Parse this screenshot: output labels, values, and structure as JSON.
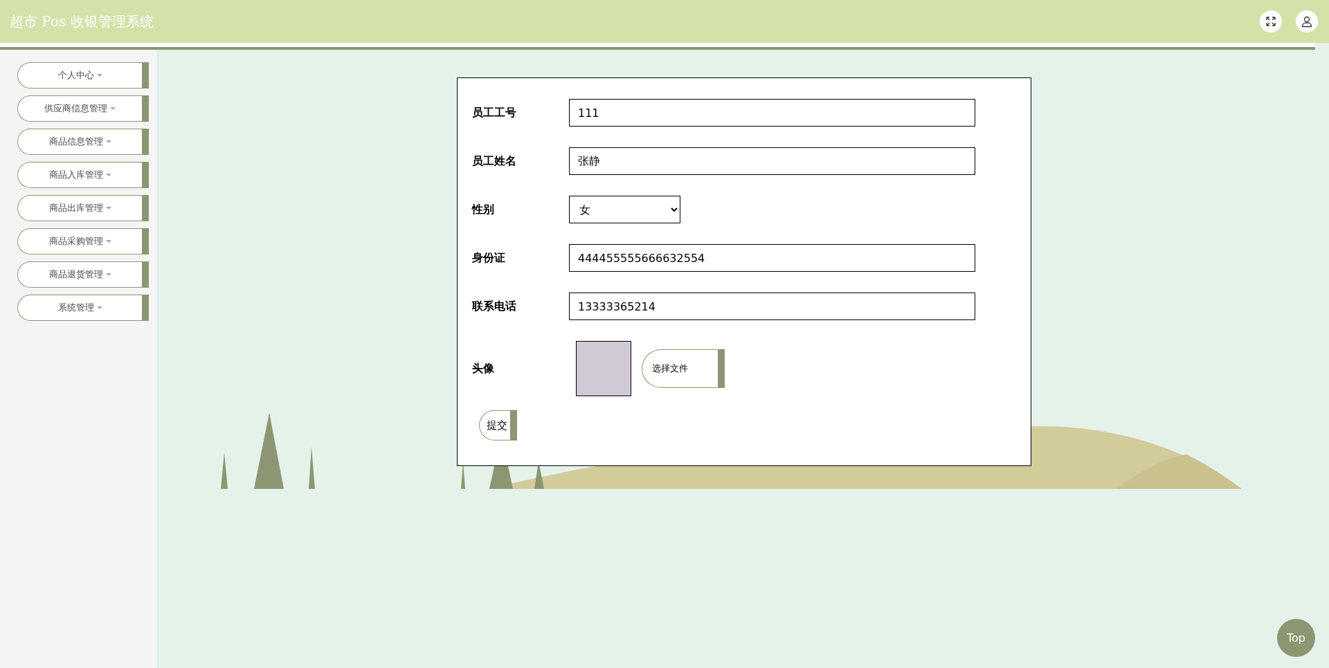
{
  "header": {
    "title": "超市 Pos 收银管理系统"
  },
  "sidebar": {
    "items": [
      {
        "label": "个人中心"
      },
      {
        "label": "供应商信息管理"
      },
      {
        "label": "商品信息管理"
      },
      {
        "label": "商品入库管理"
      },
      {
        "label": "商品出库管理"
      },
      {
        "label": "商品采购管理"
      },
      {
        "label": "商品退货管理"
      },
      {
        "label": "系统管理"
      }
    ]
  },
  "form": {
    "fields": [
      {
        "kind": "text",
        "label": "员工工号",
        "value": "111"
      },
      {
        "kind": "text",
        "label": "员工姓名",
        "value": "张静"
      },
      {
        "kind": "select",
        "label": "性别",
        "value": "女"
      },
      {
        "kind": "text",
        "label": "身份证",
        "value": "444455555666632554"
      },
      {
        "kind": "text",
        "label": "联系电话",
        "value": "13333365214"
      },
      {
        "kind": "image",
        "label": "头像",
        "button": "选择文件"
      }
    ],
    "submit": "提交"
  },
  "back_to_top": "Top"
}
